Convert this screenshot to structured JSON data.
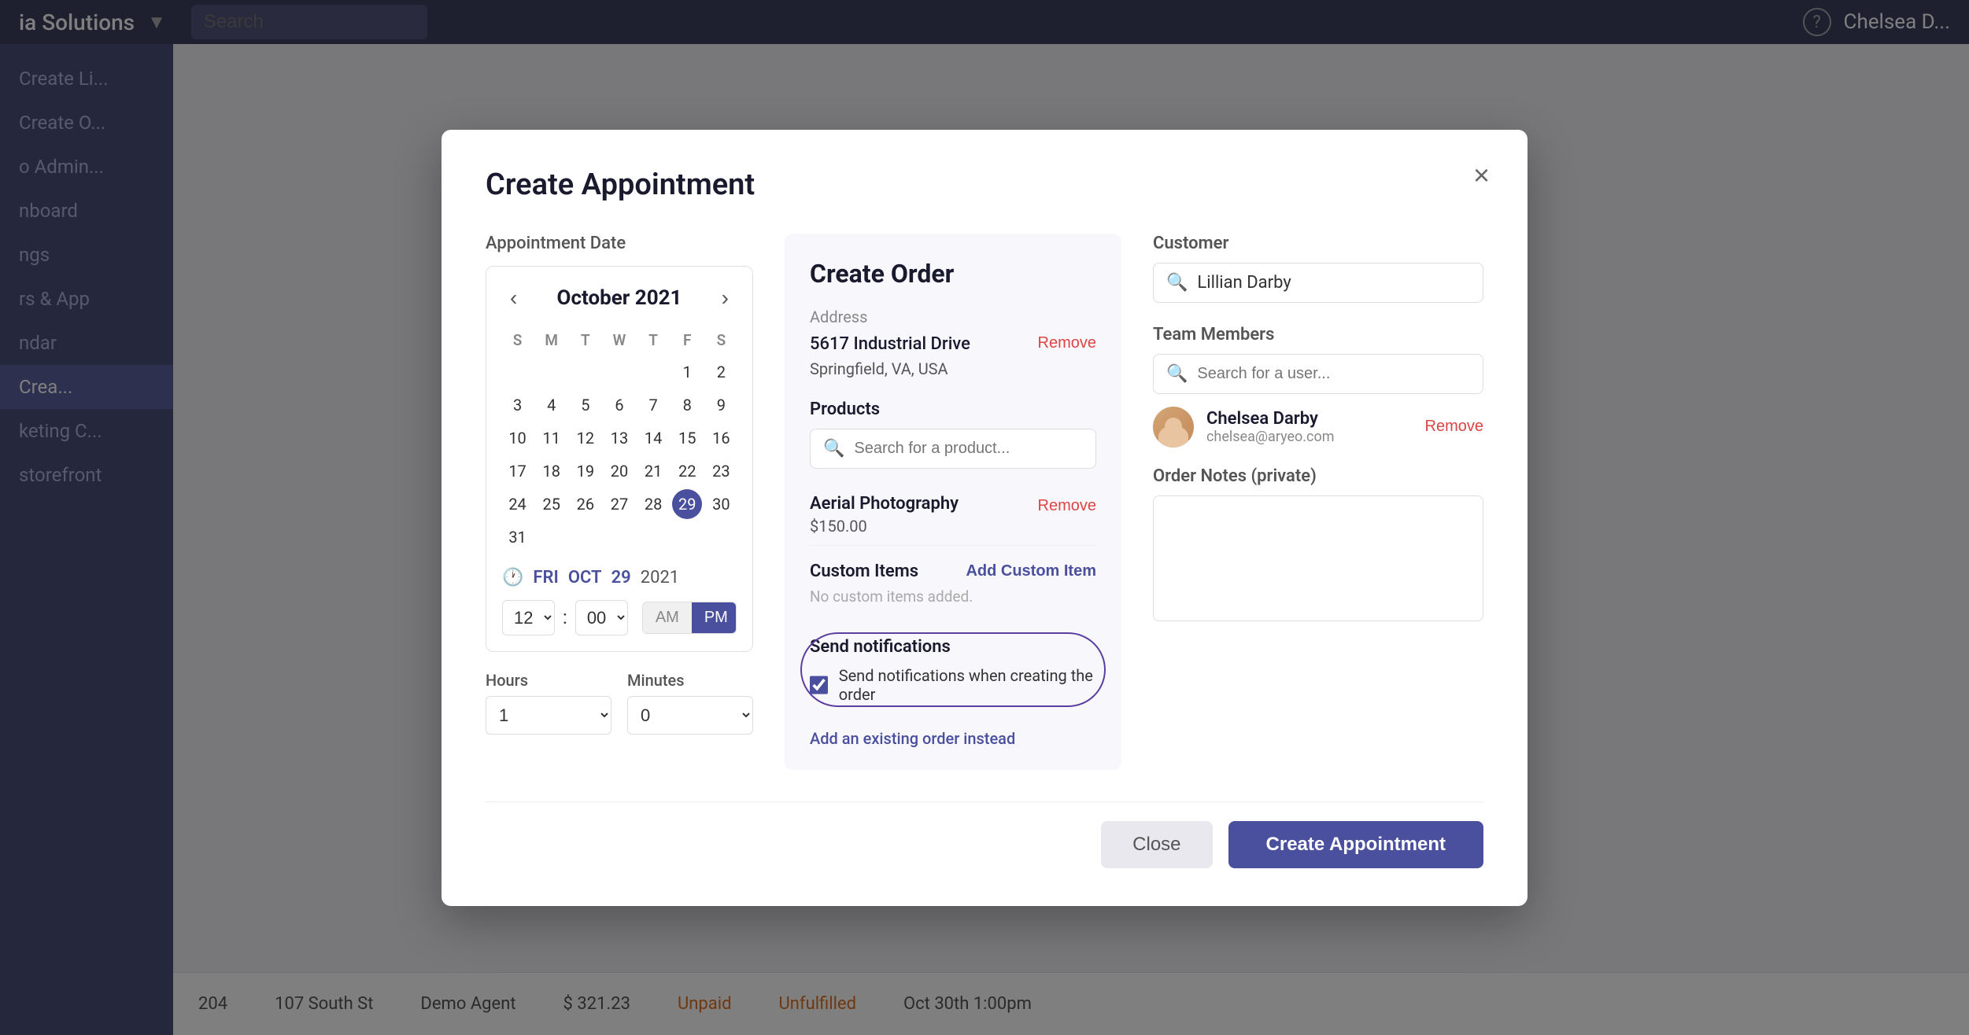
{
  "app": {
    "title": "ia Solutions",
    "search_placeholder": "Search",
    "user": "Chelsea D..."
  },
  "sidebar": {
    "items": [
      {
        "label": "Create Li...",
        "active": false
      },
      {
        "label": "Create O...",
        "active": false
      },
      {
        "label": "o Admin...",
        "active": false
      },
      {
        "label": "nboard",
        "active": false
      },
      {
        "label": "ngs",
        "active": false
      },
      {
        "label": "rs & App",
        "active": false
      },
      {
        "label": "ndar",
        "active": false
      },
      {
        "label": "keting C...",
        "active": false
      },
      {
        "label": "storefront",
        "active": false
      }
    ]
  },
  "modal": {
    "title": "Create Appointment",
    "close_label": "×",
    "left": {
      "appointment_date_label": "Appointment Date",
      "calendar": {
        "month_year": "October 2021",
        "day_labels": [
          "S",
          "M",
          "T",
          "W",
          "T",
          "F",
          "S"
        ],
        "days": [
          {
            "day": "",
            "empty": true
          },
          {
            "day": "",
            "empty": true
          },
          {
            "day": "",
            "empty": true
          },
          {
            "day": "",
            "empty": true
          },
          {
            "day": "",
            "empty": true
          },
          {
            "day": "1"
          },
          {
            "day": "2"
          },
          {
            "day": "3"
          },
          {
            "day": "4"
          },
          {
            "day": "5"
          },
          {
            "day": "6"
          },
          {
            "day": "7"
          },
          {
            "day": "8"
          },
          {
            "day": "9"
          },
          {
            "day": "10"
          },
          {
            "day": "11"
          },
          {
            "day": "12"
          },
          {
            "day": "13"
          },
          {
            "day": "14"
          },
          {
            "day": "15"
          },
          {
            "day": "16"
          },
          {
            "day": "17"
          },
          {
            "day": "18"
          },
          {
            "day": "19"
          },
          {
            "day": "20"
          },
          {
            "day": "21"
          },
          {
            "day": "22"
          },
          {
            "day": "23"
          },
          {
            "day": "24"
          },
          {
            "day": "25"
          },
          {
            "day": "26"
          },
          {
            "day": "27"
          },
          {
            "day": "28"
          },
          {
            "day": "29",
            "selected": true
          },
          {
            "day": "30"
          },
          {
            "day": "31"
          },
          {
            "day": "",
            "empty": true
          },
          {
            "day": "",
            "empty": true
          },
          {
            "day": "",
            "empty": true
          },
          {
            "day": "",
            "empty": true
          },
          {
            "day": "",
            "empty": true
          },
          {
            "day": "",
            "empty": true
          }
        ],
        "selected_day_label": "FRI",
        "selected_month": "OCT",
        "selected_date": "29",
        "selected_year": "2021"
      },
      "time": {
        "hour": "12",
        "minute": "00",
        "am": "AM",
        "pm": "PM",
        "active_period": "PM"
      },
      "hours_label": "Hours",
      "hours_value": "1",
      "minutes_label": "Minutes",
      "minutes_value": "0"
    },
    "middle": {
      "title": "Create Order",
      "address_label": "Address",
      "address_line1": "5617 Industrial Drive",
      "address_line2": "Springfield, VA, USA",
      "remove_address_label": "Remove",
      "products_label": "Products",
      "products_search_placeholder": "Search for a product...",
      "product_name": "Aerial Photography",
      "product_price": "$150.00",
      "remove_product_label": "Remove",
      "custom_items_label": "Custom Items",
      "add_custom_item_label": "Add Custom Item",
      "no_custom_text": "No custom items added.",
      "notifications_title": "Send notifications",
      "notifications_checkbox_label": "Send notifications when creating the order",
      "existing_order_link": "Add an existing order instead"
    },
    "right": {
      "customer_label": "Customer",
      "customer_value": "Lillian Darby",
      "team_members_label": "Team Members",
      "team_search_placeholder": "Search for a user...",
      "member_name": "Chelsea Darby",
      "member_email": "chelsea@aryeo.com",
      "member_remove_label": "Remove",
      "order_notes_label": "Order Notes (private)",
      "order_notes_placeholder": ""
    },
    "footer": {
      "close_label": "Close",
      "create_label": "Create Appointment"
    }
  },
  "bg_table": {
    "col1": "204",
    "col2": "107 South St",
    "col3": "Demo Agent",
    "col4": "$ 321.23",
    "col5": "Unpaid",
    "col6": "Unfulfilled",
    "col7": "Oct 30th 1:00pm"
  }
}
